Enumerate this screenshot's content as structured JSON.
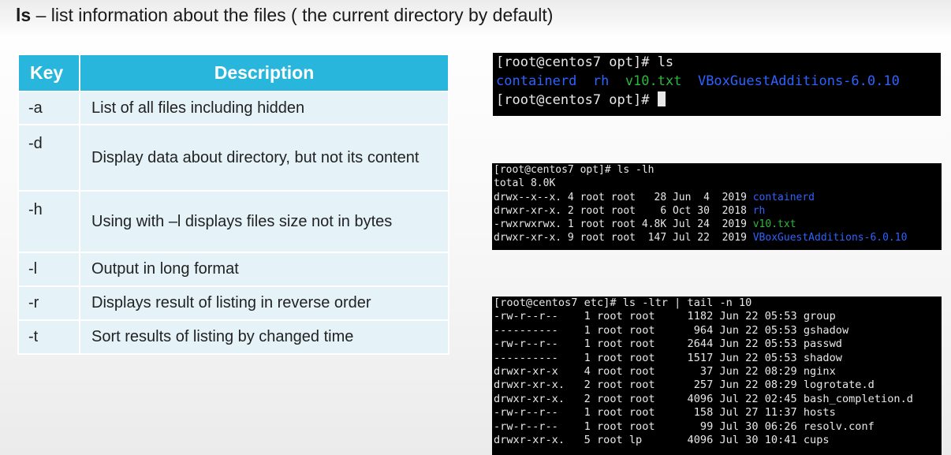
{
  "title": {
    "command": "ls",
    "text": " – list information about the files ( the current directory by default)"
  },
  "table": {
    "headers": [
      "Key",
      "Description"
    ],
    "rows": [
      {
        "key": "-a",
        "desc": "List of all files including hidden"
      },
      {
        "key": "-d",
        "desc": "Display data about directory,  but not its content"
      },
      {
        "key": "-h",
        "desc": "Using with –l displays files size not in bytes"
      },
      {
        "key": "-l",
        "desc": "Output in long format"
      },
      {
        "key": "-r",
        "desc": "Displays result of listing in reverse order"
      },
      {
        "key": "-t",
        "desc": "Sort results of listing by changed time"
      }
    ]
  },
  "terminal1": {
    "prompt1": "[root@centos7 opt]# ls",
    "items": [
      "containerd",
      "rh",
      "v10.txt",
      "VBoxGuestAdditions-6.0.10"
    ],
    "prompt2": "[root@centos7 opt]# "
  },
  "terminal2": {
    "prompt": "[root@centos7 opt]# ls -lh",
    "total": "total 8.0K",
    "rows": [
      {
        "prefix": "drwx--x--x. 4 root root   28 Jun  4  2019 ",
        "name": "containerd",
        "color": "#2f62ff"
      },
      {
        "prefix": "drwxr-xr-x. 2 root root    6 Oct 30  2018 ",
        "name": "rh",
        "color": "#2f62ff"
      },
      {
        "prefix": "-rwxrwxrwx. 1 root root 4.8K Jul 24  2019 ",
        "name": "v10.txt",
        "color": "#2db83d"
      },
      {
        "prefix": "drwxr-xr-x. 9 root root  147 Jul 22  2019 ",
        "name": "VBoxGuestAdditions-6.0.10",
        "color": "#2f62ff"
      }
    ]
  },
  "terminal3": {
    "prompt": "[root@centos7 etc]# ls -ltr | tail -n 10",
    "lines": [
      "-rw-r--r--    1 root root     1182 Jun 22 05:53 group",
      "----------    1 root root      964 Jun 22 05:53 gshadow",
      "-rw-r--r--    1 root root     2644 Jun 22 05:53 passwd",
      "----------    1 root root     1517 Jun 22 05:53 shadow",
      "drwxr-xr-x    4 root root       37 Jun 22 08:29 nginx",
      "drwxr-xr-x.   2 root root      257 Jun 22 08:29 logrotate.d",
      "drwxr-xr-x.   2 root root     4096 Jul 22 02:45 bash_completion.d",
      "-rw-r--r--    1 root root      158 Jul 27 11:37 hosts",
      "-rw-r--r--    1 root root       99 Jul 30 06:26 resolv.conf",
      "drwxr-xr-x.   5 root lp       4096 Jul 30 10:41 cups"
    ]
  }
}
